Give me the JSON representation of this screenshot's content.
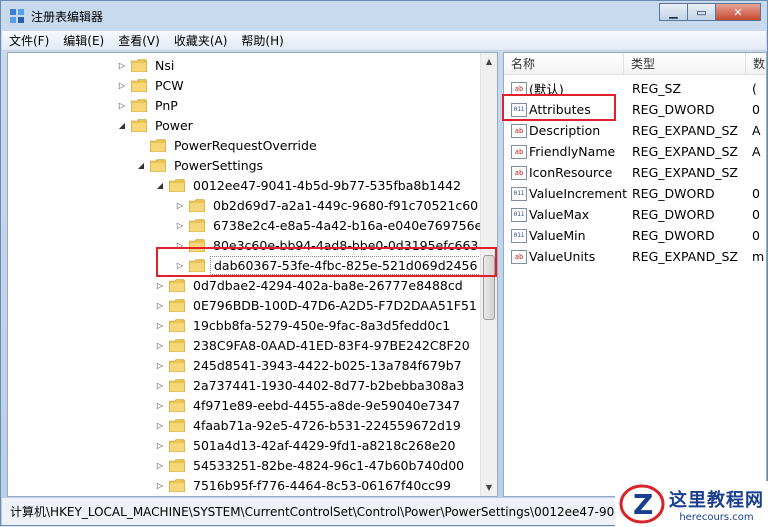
{
  "window": {
    "title": "注册表编辑器"
  },
  "menu": [
    "文件(F)",
    "编辑(E)",
    "查看(V)",
    "收藏夹(A)",
    "帮助(H)"
  ],
  "tree": [
    {
      "label": "Nsi",
      "level": 0,
      "exp": "▷"
    },
    {
      "label": "PCW",
      "level": 0,
      "exp": "▷"
    },
    {
      "label": "PnP",
      "level": 0,
      "exp": "▷"
    },
    {
      "label": "Power",
      "level": 0,
      "exp": "◢"
    },
    {
      "label": "PowerRequestOverride",
      "level": 1,
      "exp": ""
    },
    {
      "label": "PowerSettings",
      "level": 1,
      "exp": "◢"
    },
    {
      "label": "0012ee47-9041-4b5d-9b77-535fba8b1442",
      "level": 2,
      "exp": "◢"
    },
    {
      "label": "0b2d69d7-a2a1-449c-9680-f91c70521c60",
      "level": 3,
      "exp": "▷"
    },
    {
      "label": "6738e2c4-e8a5-4a42-b16a-e040e769756e",
      "level": 3,
      "exp": "▷"
    },
    {
      "label": "80e3c60e-bb94-4ad8-bbe0-0d3195efc663",
      "level": 3,
      "exp": "▷"
    },
    {
      "label": "dab60367-53fe-4fbc-825e-521d069d2456",
      "level": 3,
      "exp": "▷",
      "selected": true
    },
    {
      "label": "0d7dbae2-4294-402a-ba8e-26777e8488cd",
      "level": 2,
      "exp": "▷"
    },
    {
      "label": "0E796BDB-100D-47D6-A2D5-F7D2DAA51F51",
      "level": 2,
      "exp": "▷"
    },
    {
      "label": "19cbb8fa-5279-450e-9fac-8a3d5fedd0c1",
      "level": 2,
      "exp": "▷"
    },
    {
      "label": "238C9FA8-0AAD-41ED-83F4-97BE242C8F20",
      "level": 2,
      "exp": "▷"
    },
    {
      "label": "245d8541-3943-4422-b025-13a784f679b7",
      "level": 2,
      "exp": "▷"
    },
    {
      "label": "2a737441-1930-4402-8d77-b2bebba308a3",
      "level": 2,
      "exp": "▷"
    },
    {
      "label": "4f971e89-eebd-4455-a8de-9e59040e7347",
      "level": 2,
      "exp": "▷"
    },
    {
      "label": "4faab71a-92e5-4726-b531-224559672d19",
      "level": 2,
      "exp": "▷"
    },
    {
      "label": "501a4d13-42af-4429-9fd1-a8218c268e20",
      "level": 2,
      "exp": "▷"
    },
    {
      "label": "54533251-82be-4824-96c1-47b60b740d00",
      "level": 2,
      "exp": "▷"
    },
    {
      "label": "7516b95f-f776-4464-8c53-06167f40cc99",
      "level": 2,
      "exp": "▷"
    }
  ],
  "columns": {
    "name": "名称",
    "type": "类型",
    "data": "数"
  },
  "values": [
    {
      "name": "(默认)",
      "type": "REG_SZ",
      "data": "(",
      "kind": "sz"
    },
    {
      "name": "Attributes",
      "type": "REG_DWORD",
      "data": "0",
      "kind": "dword"
    },
    {
      "name": "Description",
      "type": "REG_EXPAND_SZ",
      "data": "A",
      "kind": "sz"
    },
    {
      "name": "FriendlyName",
      "type": "REG_EXPAND_SZ",
      "data": "A",
      "kind": "sz"
    },
    {
      "name": "IconResource",
      "type": "REG_EXPAND_SZ",
      "data": "",
      "kind": "sz"
    },
    {
      "name": "ValueIncrement",
      "type": "REG_DWORD",
      "data": "0",
      "kind": "dword"
    },
    {
      "name": "ValueMax",
      "type": "REG_DWORD",
      "data": "0",
      "kind": "dword"
    },
    {
      "name": "ValueMin",
      "type": "REG_DWORD",
      "data": "0",
      "kind": "dword"
    },
    {
      "name": "ValueUnits",
      "type": "REG_EXPAND_SZ",
      "data": "m",
      "kind": "sz"
    }
  ],
  "status": "计算机\\HKEY_LOCAL_MACHINE\\SYSTEM\\CurrentControlSet\\Control\\Power\\PowerSettings\\0012ee47-9041-4",
  "watermark": {
    "title": "这里教程网",
    "url": "herecours.com"
  },
  "icons": {
    "folder": "folder-icon",
    "sz": "ab",
    "dword": "011"
  },
  "colors": {
    "folder": "#e9c455",
    "highlight": "#e0202b"
  }
}
